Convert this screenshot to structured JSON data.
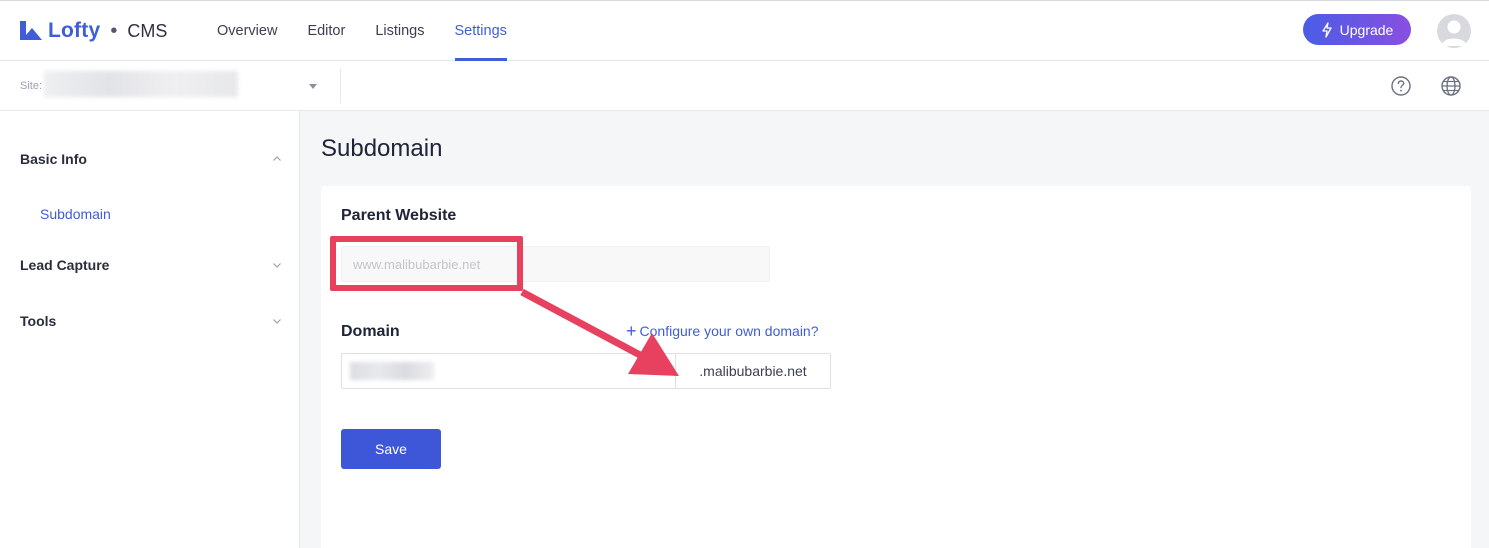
{
  "brand": {
    "name": "Lofty",
    "separator": "•",
    "product": "CMS",
    "color": "#3f5dd9"
  },
  "nav": {
    "tabs": [
      {
        "label": "Overview",
        "active": false
      },
      {
        "label": "Editor",
        "active": false
      },
      {
        "label": "Listings",
        "active": false
      },
      {
        "label": "Settings",
        "active": true
      }
    ],
    "upgrade_label": "Upgrade",
    "upgrade_icon": "lightning-icon"
  },
  "subbar": {
    "site_label": "Site:",
    "help_icon": "question-circle-icon",
    "globe_icon": "globe-icon"
  },
  "sidebar": {
    "groups": [
      {
        "label": "Basic Info",
        "expanded": true,
        "items": [
          {
            "label": "Subdomain",
            "active": true
          }
        ]
      },
      {
        "label": "Lead Capture",
        "expanded": false
      },
      {
        "label": "Tools",
        "expanded": false
      }
    ]
  },
  "main": {
    "title": "Subdomain",
    "parent_website": {
      "label": "Parent Website",
      "value": "www.malibubarbie.net"
    },
    "domain": {
      "label": "Domain",
      "configure_link": "Configure your own domain?",
      "suffix": ".malibubarbie.net"
    },
    "save_label": "Save"
  },
  "annotation": {
    "color": "#e8405f"
  }
}
